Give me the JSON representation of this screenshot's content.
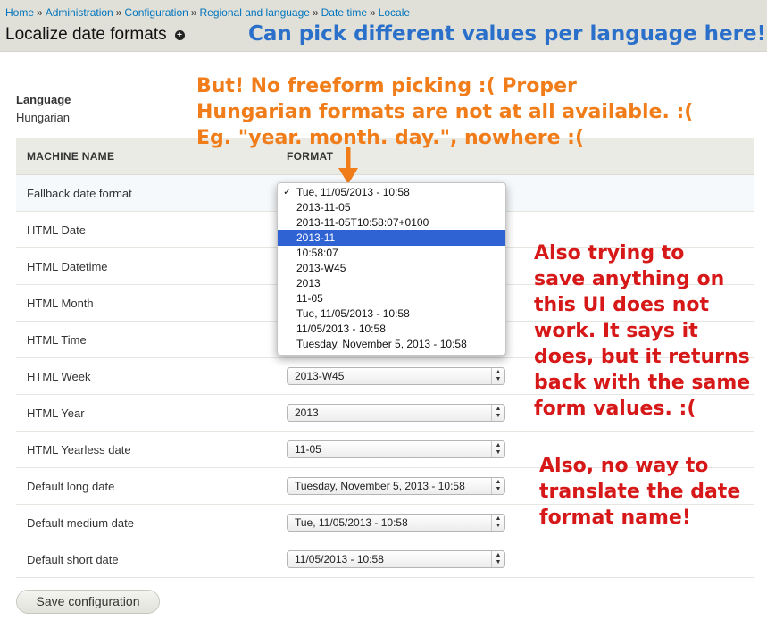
{
  "breadcrumb": [
    {
      "label": "Home"
    },
    {
      "label": "Administration"
    },
    {
      "label": "Configuration"
    },
    {
      "label": "Regional and language"
    },
    {
      "label": "Date time"
    },
    {
      "label": "Locale"
    }
  ],
  "breadcrumb_sep": "»",
  "page_title": "Localize date formats",
  "shortcut_icon": "+",
  "annotations": {
    "blue": "Can pick different values per language here!",
    "orange": "But! No freeform picking :( Proper\nHungarian formats are not at all available. :(\nEg. \"year. month. day.\", nowhere :(",
    "red1": "Also trying to\nsave anything on\nthis UI does not\nwork. It says it\ndoes, but it returns\nback with the same\nform values. :(",
    "red2": "Also, no way to\ntranslate the date\nformat name!"
  },
  "language": {
    "label": "Language",
    "value": "Hungarian"
  },
  "table": {
    "headers": {
      "machine_name": "MACHINE NAME",
      "format": "FORMAT"
    },
    "rows": [
      {
        "name": "Fallback date format",
        "value": "Tue, 11/05/2013 - 10:58"
      },
      {
        "name": "HTML Date",
        "value": "2013-11-05"
      },
      {
        "name": "HTML Datetime",
        "value": "2013-11-05T10:58:07+0100"
      },
      {
        "name": "HTML Month",
        "value": "2013-11"
      },
      {
        "name": "HTML Time",
        "value": "10:58:07"
      },
      {
        "name": "HTML Week",
        "value": "2013-W45"
      },
      {
        "name": "HTML Year",
        "value": "2013"
      },
      {
        "name": "HTML Yearless date",
        "value": "11-05"
      },
      {
        "name": "Default long date",
        "value": "Tuesday, November 5, 2013 - 10:58"
      },
      {
        "name": "Default medium date",
        "value": "Tue, 11/05/2013 - 10:58"
      },
      {
        "name": "Default short date",
        "value": "11/05/2013 - 10:58"
      }
    ]
  },
  "dropdown_options": [
    "Tue, 11/05/2013 - 10:58",
    "2013-11-05",
    "2013-11-05T10:58:07+0100",
    "2013-11",
    "10:58:07",
    "2013-W45",
    "2013",
    "11-05",
    "Tue, 11/05/2013 - 10:58",
    "11/05/2013 - 10:58",
    "Tuesday, November 5, 2013 - 10:58"
  ],
  "dropdown_checked_index": 0,
  "dropdown_hover_index": 3,
  "save_button": "Save configuration",
  "colors": {
    "annotation_blue": "#2a6fc9",
    "annotation_orange": "#f07d1a",
    "annotation_red": "#d61818",
    "link": "#0074bd",
    "selection": "#2f63d4"
  }
}
